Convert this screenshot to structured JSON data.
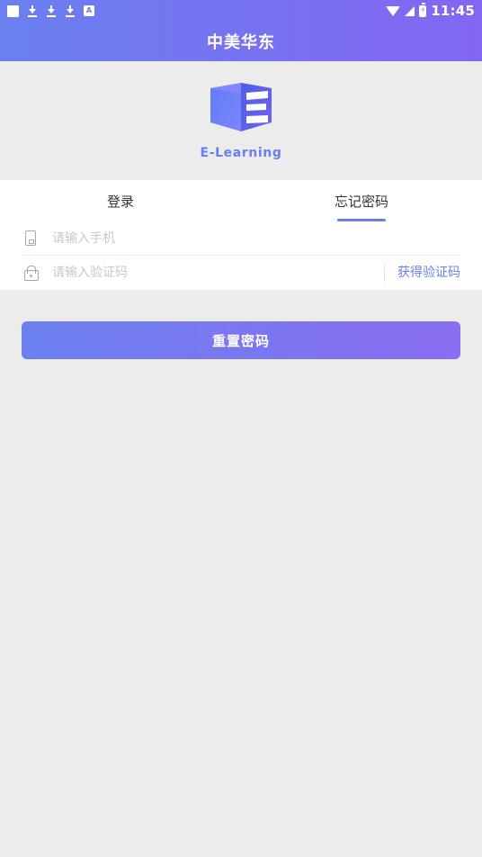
{
  "status_bar": {
    "time": "11:45",
    "left_icons": [
      "app-square-icon",
      "download-icon",
      "download-icon",
      "download-icon",
      "a-box-icon"
    ],
    "right_icons": [
      "wifi-icon",
      "signal-icon",
      "battery-charging-icon"
    ],
    "battery_glyph": "⚡",
    "a_glyph": "A"
  },
  "header": {
    "title": "中美华东",
    "gradient_start": "#6a80ef",
    "gradient_end": "#8366f2"
  },
  "logo": {
    "name": "e-learning-logo",
    "caption": "E-Learning",
    "color": "#6b7ef0"
  },
  "tabs": [
    {
      "label": "登录",
      "name": "tab-login",
      "active": false
    },
    {
      "label": "忘记密码",
      "name": "tab-forgot-password",
      "active": true
    }
  ],
  "form": {
    "phone": {
      "placeholder": "请输入手机",
      "value": "",
      "icon": "phone-icon"
    },
    "code": {
      "placeholder": "请输入验证码",
      "value": "",
      "icon": "lock-icon",
      "action_label": "获得验证码"
    }
  },
  "submit": {
    "label": "重置密码",
    "gradient_start": "#6b80ef",
    "gradient_end": "#8a6df0"
  },
  "theme": {
    "page_background": "#ececec",
    "accent": "#6b7ef0",
    "card_background": "#ffffff"
  }
}
